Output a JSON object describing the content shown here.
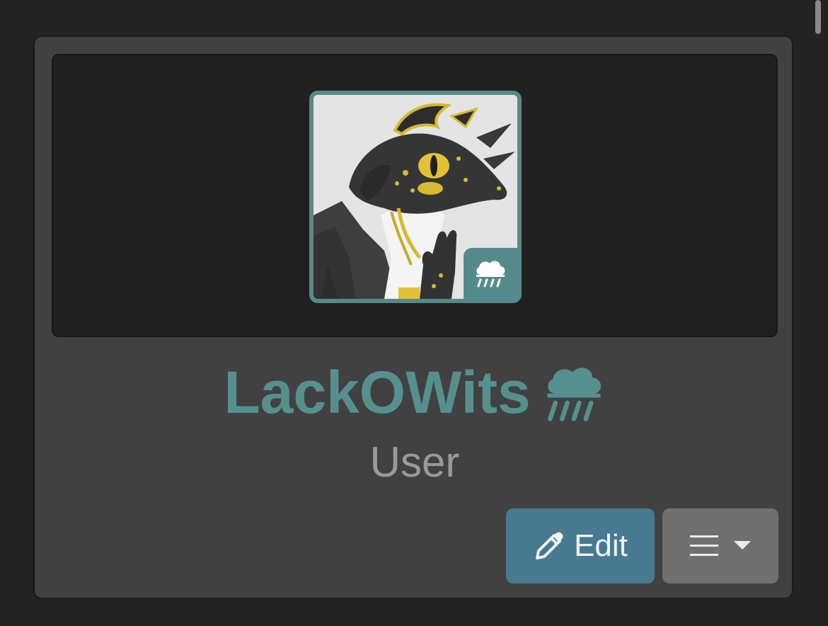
{
  "profile": {
    "username": "LackOWits",
    "role": "User",
    "element_icon": "rain-cloud-icon",
    "accent_color": "#558a8a"
  },
  "avatar": {
    "badge_icon": "rain-cloud-icon"
  },
  "actions": {
    "edit_label": "Edit",
    "edit_icon": "pencil-icon",
    "menu_icon": "hamburger-menu-icon",
    "menu_caret_icon": "caret-down-icon",
    "edit_color": "#477a90",
    "menu_color": "#707070"
  }
}
